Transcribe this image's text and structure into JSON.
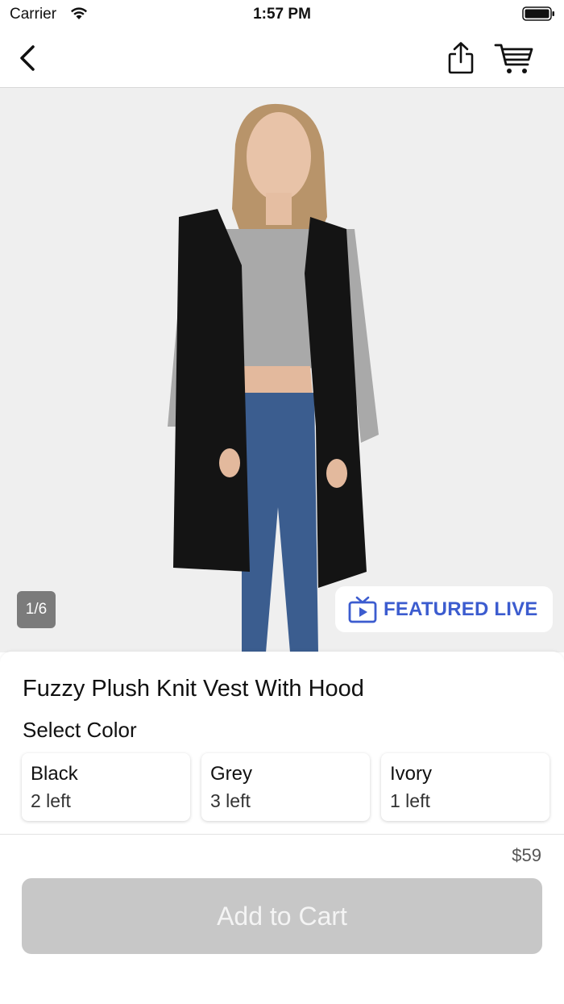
{
  "status_bar": {
    "carrier": "Carrier",
    "time": "1:57 PM"
  },
  "nav": {
    "back_icon": "chevron-left-icon",
    "share_icon": "share-icon",
    "cart_icon": "cart-icon"
  },
  "gallery": {
    "counter": "1/6",
    "current_image": 1,
    "total_images": 6,
    "featured_badge": {
      "label": "FEATURED LIVE",
      "icon": "tv-play-icon",
      "color": "#3c5ccf"
    }
  },
  "product": {
    "title": "Fuzzy Plush Knit Vest With Hood",
    "select_color_label": "Select Color",
    "colors": [
      {
        "name": "Black",
        "stock": "2 left"
      },
      {
        "name": "Grey",
        "stock": "3 left"
      },
      {
        "name": "Ivory",
        "stock": "1 left"
      }
    ],
    "price": "$59"
  },
  "actions": {
    "add_to_cart_label": "Add to Cart",
    "add_to_cart_disabled": true,
    "add_to_cart_color": "#c7c7c7"
  }
}
